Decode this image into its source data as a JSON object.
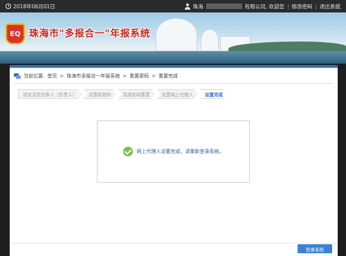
{
  "topbar": {
    "date": "2018年06月01日",
    "user_prefix": "珠海",
    "user_suffix": "有限公司, 欢迎您",
    "change_password": "修改密码",
    "logout": "退出系统",
    "separator": "|"
  },
  "banner": {
    "logo_text": "EQ",
    "site_title": "珠海市\"多报合一\"年报系统"
  },
  "breadcrumb": {
    "label": "当前位置: ",
    "items": [
      "首页",
      "珠海市多报合一年报系统",
      "重置密码",
      "重置完成"
    ],
    "divider": " > "
  },
  "steps": [
    {
      "label": "验证法定代表人（负责人）"
    },
    {
      "label": "设置新密码"
    },
    {
      "label": "完成密码重置"
    },
    {
      "label": "设置网上代理人"
    },
    {
      "label": "设置完成"
    }
  ],
  "message": "网上代理人设置完成，请重新登录系统。",
  "login_button": "登录系统",
  "colors": {
    "accent": "#2f73c6",
    "success": "#7ac143",
    "brand_red": "#c7261f"
  }
}
